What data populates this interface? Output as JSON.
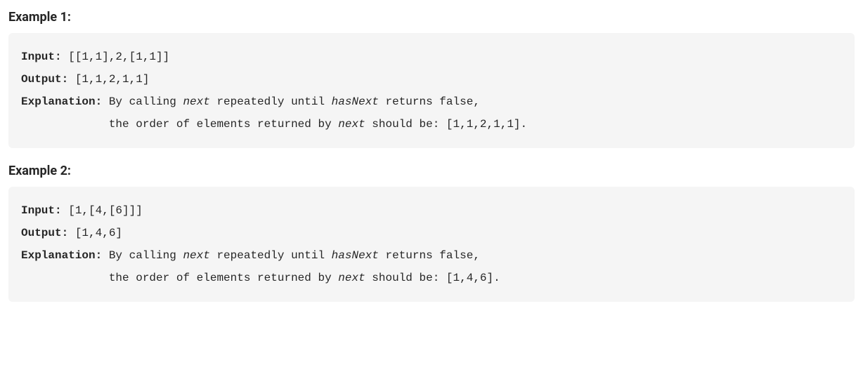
{
  "example1": {
    "heading": "Example 1:",
    "input_label": "Input:",
    "input_value": " [[1,1],2,[1,1]]",
    "output_label": "Output:",
    "output_value": " [1,1,2,1,1]",
    "explanation_label": "Explanation:",
    "line1_part1": " By calling ",
    "line1_next": "next",
    "line1_part2": " repeatedly until ",
    "line1_hasnext": "hasNext",
    "line1_part3": " returns false, ",
    "line2_part1": "             the order of elements returned by ",
    "line2_next": "next",
    "line2_part2": " should be: ",
    "line2_value": "[1,1,2,1,1]",
    "line2_part3": "."
  },
  "example2": {
    "heading": "Example 2:",
    "input_label": "Input:",
    "input_value": " [1,[4,[6]]]",
    "output_label": "Output:",
    "output_value": " [1,4,6]",
    "explanation_label": "Explanation:",
    "line1_part1": " By calling ",
    "line1_next": "next",
    "line1_part2": " repeatedly until ",
    "line1_hasnext": "hasNext",
    "line1_part3": " returns false, ",
    "line2_part1": "             the order of elements returned by ",
    "line2_next": "next",
    "line2_part2": " should be: ",
    "line2_value": "[1,4,6]",
    "line2_part3": "."
  }
}
